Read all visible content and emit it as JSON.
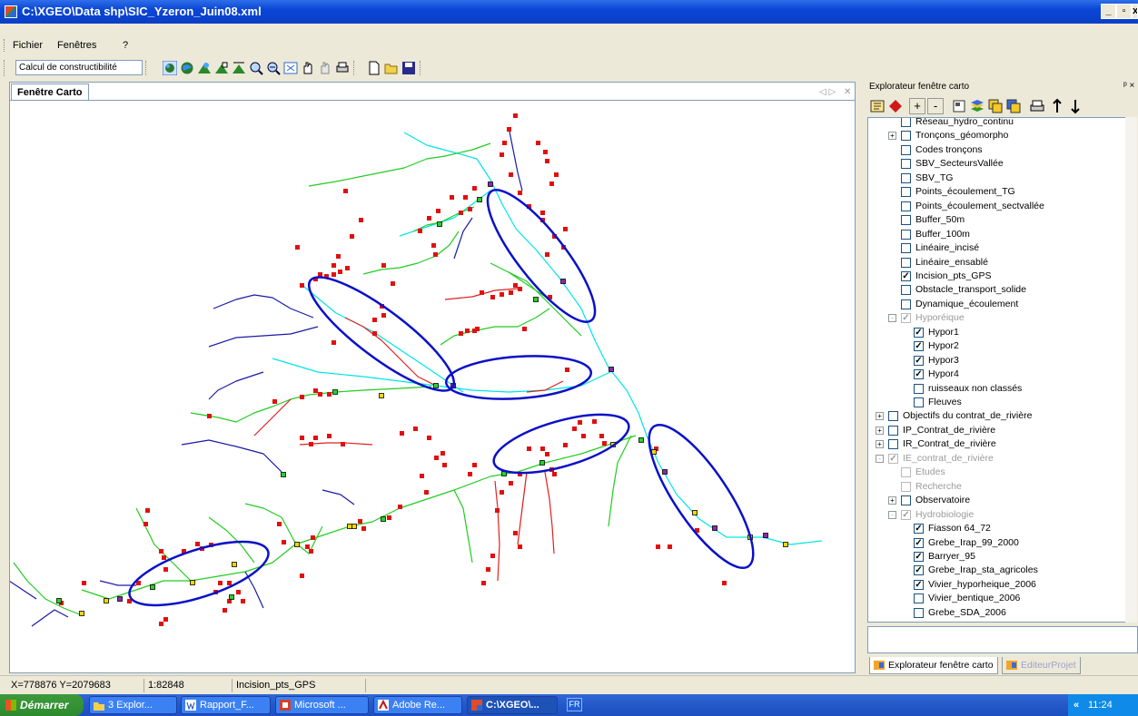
{
  "window": {
    "title": "C:\\XGEO\\Data shp\\SIC_Yzeron_Juin08.xml"
  },
  "menu": [
    "Fichier",
    "Fenêtres",
    "?"
  ],
  "toolbar": {
    "combo_value": "Calcul de constructibilité"
  },
  "doc_tab": {
    "label": "Fenêtre Carto"
  },
  "map": {
    "colors": {
      "river": "#00e5e5",
      "stream_green": "#22cc22",
      "stream_blue": "#1a1aa8",
      "stream_red": "#e02020",
      "points": "#e01010",
      "ellipse": "#0a10c8"
    }
  },
  "explorer": {
    "title": "Explorateur fenêtre carto",
    "items": [
      {
        "label": "Réseau_hydro_continu",
        "checked": false,
        "expander": "",
        "indent": 0,
        "gray": false
      },
      {
        "label": "Tronçons_géomorpho",
        "checked": false,
        "expander": "+",
        "indent": 0,
        "gray": false
      },
      {
        "label": "Codes tronçons",
        "checked": false,
        "expander": "",
        "indent": 0,
        "gray": false
      },
      {
        "label": "SBV_SecteursVallée",
        "checked": false,
        "expander": "",
        "indent": 0,
        "gray": false
      },
      {
        "label": "SBV_TG",
        "checked": false,
        "expander": "",
        "indent": 0,
        "gray": false
      },
      {
        "label": "Points_écoulement_TG",
        "checked": false,
        "expander": "",
        "indent": 0,
        "gray": false
      },
      {
        "label": "Points_écoulement_sectvallée",
        "checked": false,
        "expander": "",
        "indent": 0,
        "gray": false
      },
      {
        "label": "Buffer_50m",
        "checked": false,
        "expander": "",
        "indent": 0,
        "gray": false
      },
      {
        "label": "Buffer_100m",
        "checked": false,
        "expander": "",
        "indent": 0,
        "gray": false
      },
      {
        "label": "Linéaire_incisé",
        "checked": false,
        "expander": "",
        "indent": 0,
        "gray": false
      },
      {
        "label": "Linéaire_ensablé",
        "checked": false,
        "expander": "",
        "indent": 0,
        "gray": false
      },
      {
        "label": "Incision_pts_GPS",
        "checked": true,
        "expander": "",
        "indent": 0,
        "gray": false
      },
      {
        "label": "Obstacle_transport_solide",
        "checked": false,
        "expander": "",
        "indent": 0,
        "gray": false
      },
      {
        "label": "Dynamique_écoulement",
        "checked": false,
        "expander": "",
        "indent": 0,
        "gray": false
      },
      {
        "label": "Hyporéique",
        "checked": true,
        "expander": "-",
        "indent": 0,
        "gray": true
      },
      {
        "label": "Hypor1",
        "checked": true,
        "expander": "",
        "indent": 1,
        "gray": false
      },
      {
        "label": "Hypor2",
        "checked": true,
        "expander": "",
        "indent": 1,
        "gray": false
      },
      {
        "label": "Hypor3",
        "checked": true,
        "expander": "",
        "indent": 1,
        "gray": false
      },
      {
        "label": "Hypor4",
        "checked": true,
        "expander": "",
        "indent": 1,
        "gray": false
      },
      {
        "label": "ruisseaux non classés",
        "checked": false,
        "expander": "",
        "indent": 1,
        "gray": false
      },
      {
        "label": "Fleuves",
        "checked": false,
        "expander": "",
        "indent": 1,
        "gray": false
      },
      {
        "label": "Objectifs du contrat_de_rivière",
        "checked": false,
        "expander": "+",
        "indent": -1,
        "gray": false
      },
      {
        "label": "IP_Contrat_de_rivière",
        "checked": false,
        "expander": "+",
        "indent": -1,
        "gray": false
      },
      {
        "label": "IR_Contrat_de_rivière",
        "checked": false,
        "expander": "+",
        "indent": -1,
        "gray": false
      },
      {
        "label": "IE_contrat_de_rivière",
        "checked": true,
        "expander": "-",
        "indent": -1,
        "gray": true
      },
      {
        "label": "Etudes",
        "checked": false,
        "expander": "",
        "indent": 0,
        "gray": true
      },
      {
        "label": "Recherche",
        "checked": false,
        "expander": "",
        "indent": 0,
        "gray": true
      },
      {
        "label": "Observatoire",
        "checked": false,
        "expander": "+",
        "indent": 0,
        "gray": false
      },
      {
        "label": "Hydrobiologie",
        "checked": true,
        "expander": "-",
        "indent": 0,
        "gray": true
      },
      {
        "label": "Fiasson 64_72",
        "checked": true,
        "expander": "",
        "indent": 1,
        "gray": false
      },
      {
        "label": "Grebe_Irap_99_2000",
        "checked": true,
        "expander": "",
        "indent": 1,
        "gray": false
      },
      {
        "label": "Barryer_95",
        "checked": true,
        "expander": "",
        "indent": 1,
        "gray": false
      },
      {
        "label": "Grebe_Irap_sta_agricoles",
        "checked": true,
        "expander": "",
        "indent": 1,
        "gray": false
      },
      {
        "label": "Vivier_hyporheique_2006",
        "checked": true,
        "expander": "",
        "indent": 1,
        "gray": false
      },
      {
        "label": "Vivier_bentique_2006",
        "checked": false,
        "expander": "",
        "indent": 1,
        "gray": false
      },
      {
        "label": "Grebe_SDA_2006",
        "checked": false,
        "expander": "",
        "indent": 1,
        "gray": false
      }
    ],
    "tabs": [
      "Explorateur fenêtre carto",
      "EditeurProjet"
    ]
  },
  "status": {
    "coords": "X=778876 Y=2079683",
    "scale": "1:82848",
    "layer": "Incision_pts_GPS"
  },
  "taskbar": {
    "start": "Démarrer",
    "tasks": [
      "3 Explor...",
      "Rapport_F...",
      "Microsoft ...",
      "Adobe Re...",
      "C:\\XGEO\\..."
    ],
    "lang": "FR",
    "clock": "11:24"
  }
}
